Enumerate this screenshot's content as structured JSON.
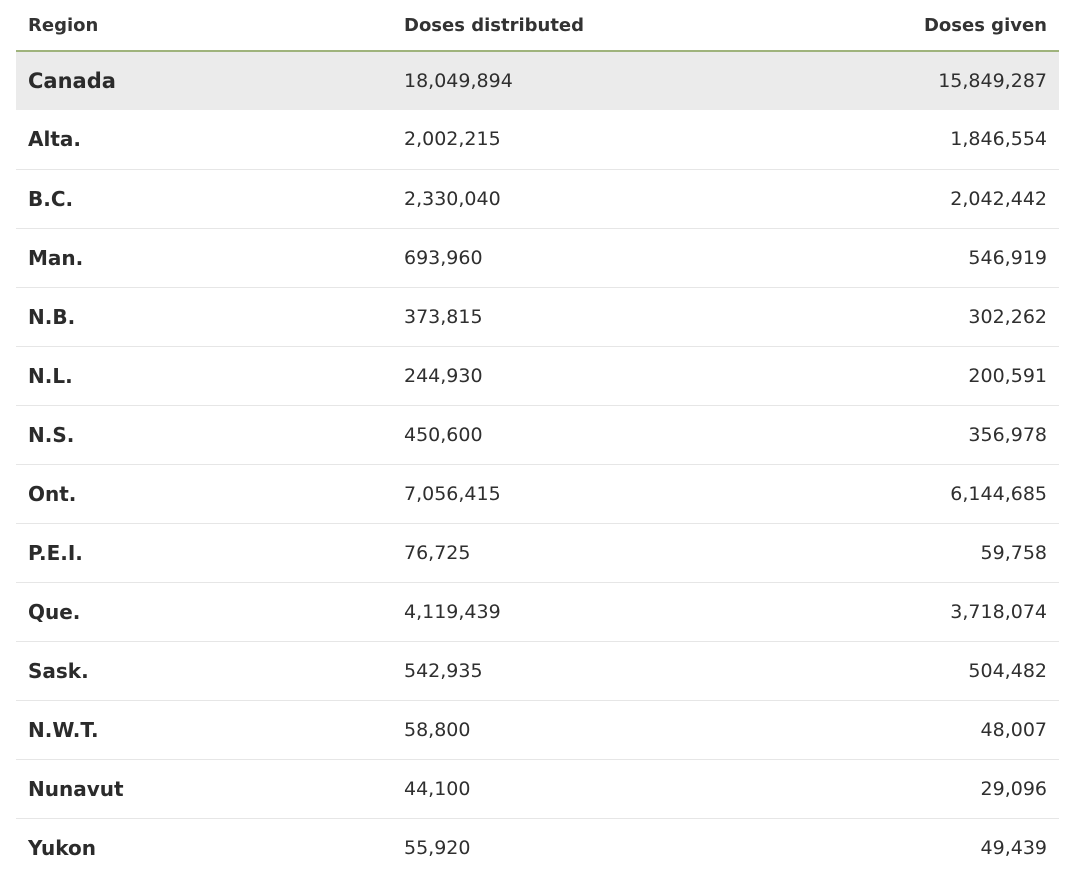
{
  "chart_data": {
    "type": "table",
    "columns": [
      "Region",
      "Doses distributed",
      "Doses given"
    ],
    "rows": [
      {
        "region": "Canada",
        "distributed": "18,049,894",
        "given": "15,849,287"
      },
      {
        "region": "Alta.",
        "distributed": "2,002,215",
        "given": "1,846,554"
      },
      {
        "region": "B.C.",
        "distributed": "2,330,040",
        "given": "2,042,442"
      },
      {
        "region": "Man.",
        "distributed": "693,960",
        "given": "546,919"
      },
      {
        "region": "N.B.",
        "distributed": "373,815",
        "given": "302,262"
      },
      {
        "region": "N.L.",
        "distributed": "244,930",
        "given": "200,591"
      },
      {
        "region": "N.S.",
        "distributed": "450,600",
        "given": "356,978"
      },
      {
        "region": "Ont.",
        "distributed": "7,056,415",
        "given": "6,144,685"
      },
      {
        "region": "P.E.I.",
        "distributed": "76,725",
        "given": "59,758"
      },
      {
        "region": "Que.",
        "distributed": "4,119,439",
        "given": "3,718,074"
      },
      {
        "region": "Sask.",
        "distributed": "542,935",
        "given": "504,482"
      },
      {
        "region": "N.W.T.",
        "distributed": "58,800",
        "given": "48,007"
      },
      {
        "region": "Nunavut",
        "distributed": "44,100",
        "given": "29,096"
      },
      {
        "region": "Yukon",
        "distributed": "55,920",
        "given": "49,439"
      }
    ]
  },
  "colors": {
    "header_rule": "#9fb37c",
    "total_row_bg": "#ebebeb",
    "row_divider": "#e6e6e6"
  }
}
